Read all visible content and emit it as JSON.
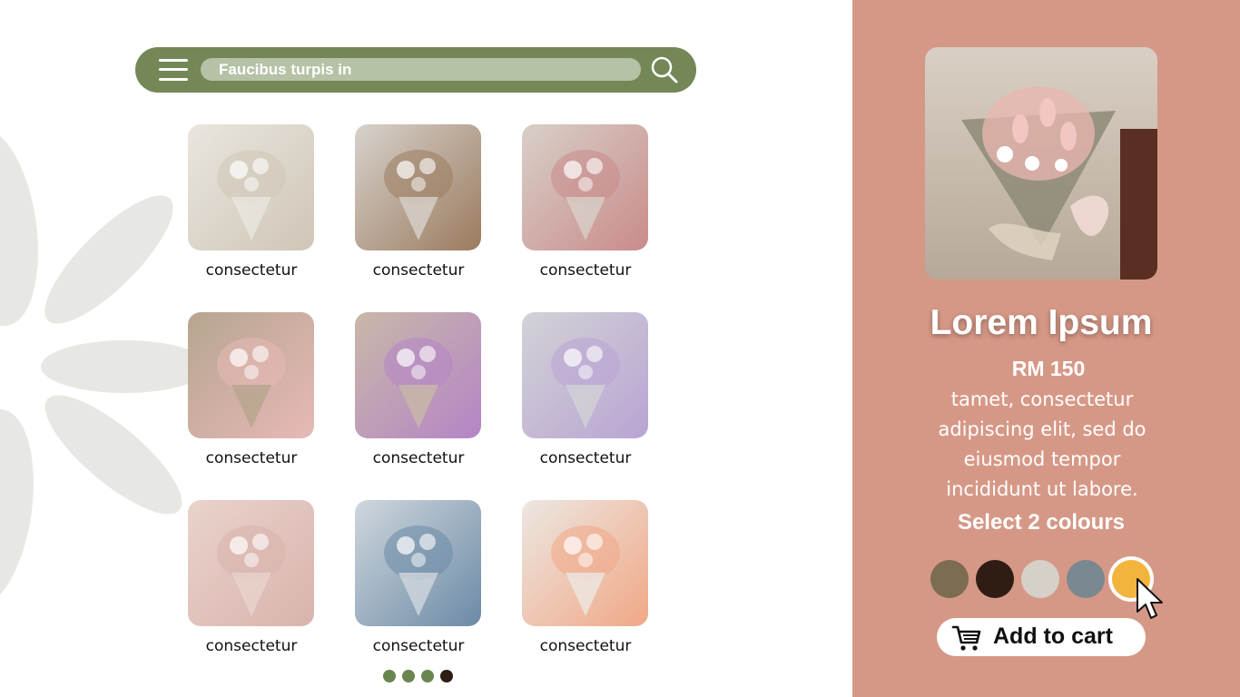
{
  "search": {
    "value": "Faucibus turpis in",
    "placeholder": "Faucibus turpis in"
  },
  "grid": {
    "items": [
      {
        "label": "consectetur",
        "image": "white-daisy-bouquet",
        "colors": [
          "#e9e6df",
          "#cfc6b6"
        ]
      },
      {
        "label": "consectetur",
        "image": "white-lily-bouquet-brown-wrap",
        "colors": [
          "#d7d2cc",
          "#9b7b5e"
        ]
      },
      {
        "label": "consectetur",
        "image": "flower-arch-box",
        "colors": [
          "#d8d0c8",
          "#c98b8b"
        ]
      },
      {
        "label": "consectetur",
        "image": "pink-tulip-bouquet",
        "colors": [
          "#b6a58f",
          "#e7b9b7"
        ]
      },
      {
        "label": "consectetur",
        "image": "purple-yellow-flower-box",
        "colors": [
          "#c9b8a8",
          "#b485c6"
        ]
      },
      {
        "label": "consectetur",
        "image": "purple-tulip-bouquet",
        "colors": [
          "#d2d2d6",
          "#b9a4d3"
        ]
      },
      {
        "label": "consectetur",
        "image": "pink-flower-book-box",
        "colors": [
          "#e9d3cb",
          "#d9b3ad"
        ]
      },
      {
        "label": "consectetur",
        "image": "blue-hydrangea-bouquet",
        "colors": [
          "#cfd7dd",
          "#6c8aa6"
        ]
      },
      {
        "label": "consectetur",
        "image": "peach-gerbera-bouquet",
        "colors": [
          "#ece7e2",
          "#f0a886"
        ]
      }
    ]
  },
  "pagination": {
    "count": 4,
    "active_index": 3
  },
  "detail": {
    "image": "pink-tulip-bouquet-large",
    "title": "Lorem Ipsum",
    "price": "RM 150",
    "description": "tamet, consectetur adipiscing elit, sed do eiusmod tempor incididunt ut labore.",
    "select_label": "Select 2 colours",
    "swatches": [
      {
        "name": "olive-brown",
        "color": "#7b6c52",
        "selected": false
      },
      {
        "name": "dark-brown",
        "color": "#2f1d14",
        "selected": false
      },
      {
        "name": "light-grey",
        "color": "#d5d1c8",
        "selected": false
      },
      {
        "name": "slate-blue",
        "color": "#7a8891",
        "selected": false
      },
      {
        "name": "yellow",
        "color": "#f2b43c",
        "selected": true
      }
    ],
    "cart_label": "Add to cart"
  },
  "colors": {
    "searchbar": "#738757",
    "search_input": "#b6c2a6",
    "panel": "#d69886",
    "pagination": "#6b8550",
    "pagination_active": "#2e1d14"
  }
}
